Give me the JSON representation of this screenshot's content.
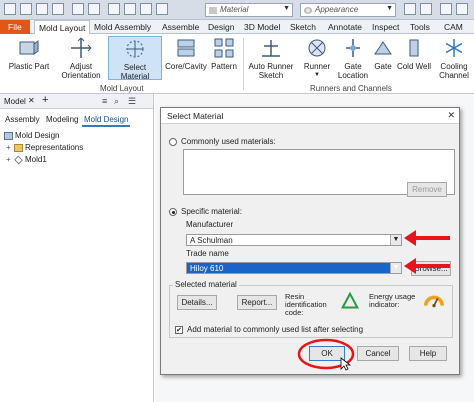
{
  "topbar": {
    "file_label": "File",
    "material_combo": "Material",
    "appearance_combo": "Appearance"
  },
  "tabs": [
    "Mold Layout",
    "Mold Assembly",
    "Assemble",
    "Design",
    "3D Model",
    "Sketch",
    "Annotate",
    "Inspect",
    "Tools",
    "CAM"
  ],
  "ribbon": {
    "buttons": [
      "Plastic Part",
      "Adjust Orientation",
      "Select Material",
      "Core/Cavity",
      "Pattern",
      "Auto Runner Sketch",
      "Runner",
      "Gate Location",
      "Gate",
      "Cold Well",
      "Cooling Channel"
    ],
    "panels": [
      "Mold Layout",
      "Runners and Channels"
    ]
  },
  "browser": {
    "title": "Model",
    "tabs": [
      "Assembly",
      "Modeling",
      "Mold Design"
    ],
    "tree": [
      "Mold Design",
      "Representations",
      "Mold1"
    ]
  },
  "dialog": {
    "title": "Select Material",
    "commonly_used_label": "Commonly used materials:",
    "remove_label": "Remove",
    "specific_label": "Specific material:",
    "manufacturer_label": "Manufacturer",
    "manufacturer_value": "A Schulman",
    "trade_name_label": "Trade name",
    "trade_name_value": "Hiloy 610",
    "browse_label": "Browse...",
    "selected_material_label": "Selected material",
    "details_label": "Details...",
    "report_label": "Report...",
    "resin_label": "Resin identification code:",
    "energy_label": "Energy usage indicator:",
    "add_material_label": "Add material to commonly used list after selecting",
    "ok_label": "OK",
    "cancel_label": "Cancel",
    "help_label": "Help"
  },
  "colors": {
    "file_tab": "#e2561a",
    "selection": "#1a63c9",
    "annotation_red": "#e8131b",
    "recycle_green": "#2a9d44"
  }
}
